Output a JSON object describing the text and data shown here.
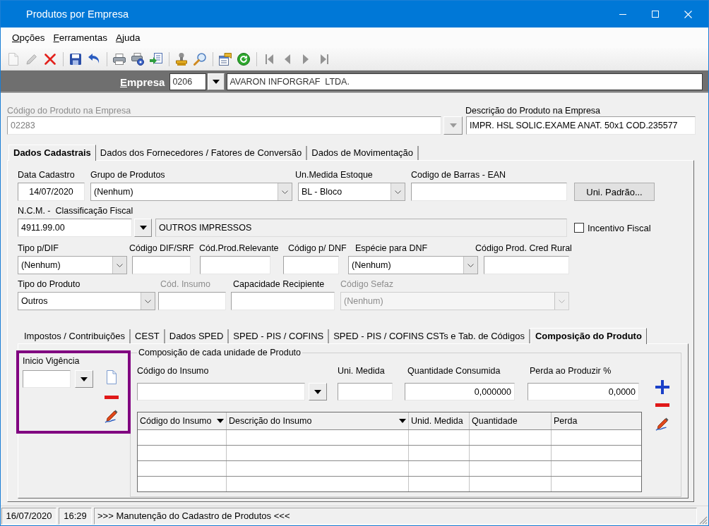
{
  "window": {
    "title": "Produtos por Empresa"
  },
  "menu": [
    "Opções",
    "Ferramentas",
    "Ajuda"
  ],
  "toolbar": [
    [
      {
        "kind": "new",
        "disabled": true
      },
      {
        "kind": "edit",
        "disabled": true
      },
      {
        "kind": "delete",
        "disabled": false
      }
    ],
    [
      {
        "kind": "save",
        "disabled": false
      },
      {
        "kind": "undo",
        "disabled": false
      }
    ],
    [
      {
        "kind": "print",
        "disabled": false
      },
      {
        "kind": "print_setup",
        "disabled": false
      },
      {
        "kind": "export",
        "disabled": false
      }
    ],
    [
      {
        "kind": "stamp",
        "disabled": false
      },
      {
        "kind": "search",
        "disabled": false
      }
    ],
    [
      {
        "kind": "properties",
        "disabled": false
      },
      {
        "kind": "refresh",
        "disabled": false
      }
    ],
    [
      {
        "kind": "first",
        "disabled": true
      },
      {
        "kind": "previous",
        "disabled": true
      },
      {
        "kind": "next",
        "disabled": true
      },
      {
        "kind": "last",
        "disabled": true
      }
    ]
  ],
  "company": {
    "label": "Empresa",
    "code": "0206",
    "name": "AVARON INFORGRAF  LTDA."
  },
  "product": {
    "code": {
      "label": "Código do Produto na Empresa",
      "value": "02283",
      "disabled": true
    },
    "description": {
      "label": "Descrição do Produto na Empresa",
      "value": "IMPR. HSL SOLIC.EXAME ANAT. 50x1 COD.235577"
    }
  },
  "tabs": [
    {
      "label": "Dados Cadastrais",
      "selected": true
    },
    {
      "label": "Dados dos Fornecedores / Fatores de Conversão",
      "selected": false
    },
    {
      "label": "Dados de Movimentação",
      "selected": false
    }
  ],
  "general_rows": [
    [
      {
        "kind": "date",
        "label": "Data Cadastro",
        "value": "14/07/2020",
        "disabled": false
      },
      {
        "kind": "combo",
        "label": "Grupo de Produtos",
        "value": "(Nenhum)",
        "disabled": false
      },
      {
        "kind": "combo",
        "label": "Un.Medida Estoque",
        "value": "BL - Bloco",
        "disabled": false
      },
      {
        "kind": "text",
        "label": "Codigo de Barras - EAN",
        "disabled": false
      },
      {
        "kind": "button",
        "label": "Uni. Padrão...",
        "disabled": false
      }
    ],
    [
      {
        "kind": "lookup",
        "label": "N.C.M. -  Classificação Fiscal",
        "value": "4911.99.00",
        "description": "OUTROS IMPRESSOS",
        "disabled": false
      },
      {
        "kind": "checkbox",
        "label": "Incentivo Fiscal",
        "checked": false,
        "disabled": false
      }
    ],
    [
      {
        "kind": "combo",
        "label": "Tipo p/DIF",
        "value": "(Nenhum)",
        "disabled": false
      },
      {
        "kind": "text",
        "label": "Código DIF/SRF",
        "disabled": false
      },
      {
        "kind": "text",
        "label": "Cód.Prod.Relevante",
        "disabled": false
      },
      {
        "kind": "text",
        "label": "Código p/ DNF",
        "disabled": false
      },
      {
        "kind": "combo",
        "label": "Espécie para DNF",
        "value": "(Nenhum)",
        "disabled": false
      },
      {
        "kind": "text",
        "label": "Código Prod. Cred Rural",
        "disabled": false
      }
    ],
    [
      {
        "kind": "combo",
        "label": "Tipo do Produto",
        "value": "Outros",
        "disabled": false
      },
      {
        "kind": "text",
        "label": "Cód. Insumo",
        "disabled": true
      },
      {
        "kind": "text",
        "label": "Capacidade Recipiente",
        "disabled": false
      },
      {
        "kind": "combo",
        "label": "Código Sefaz",
        "value": "(Nenhum)",
        "disabled": true
      }
    ]
  ],
  "sub_tabs": [
    {
      "label": "Impostos / Contribuições",
      "selected": false
    },
    {
      "label": "CEST",
      "selected": false
    },
    {
      "label": "Dados SPED",
      "selected": false
    },
    {
      "label": "SPED - PIS / COFINS",
      "selected": false
    },
    {
      "label": "SPED - PIS / COFINS CSTs e Tab. de Códigos",
      "selected": false
    },
    {
      "label": "Composição do Produto",
      "selected": true
    }
  ],
  "validity": {
    "label": "Inicio Vigência",
    "highlighted": true
  },
  "composition": {
    "title": "Composição de cada unidade de Produto",
    "fields": [
      {
        "kind": "lookup",
        "label": "Código do Insumo"
      },
      {
        "kind": "text",
        "label": "Uni. Medida"
      },
      {
        "kind": "number",
        "label": "Quantidade Consumida",
        "value": "0,000000"
      },
      {
        "kind": "number",
        "label": "Perda ao Produzir %",
        "value": "0,0000"
      }
    ],
    "columns": [
      {
        "label": "Código do Insumo",
        "dropdown": true
      },
      {
        "label": "Descrição do Insumo",
        "dropdown": true
      },
      {
        "label": "Unid. Medida",
        "dropdown": false
      },
      {
        "label": "Quantidade",
        "dropdown": false
      },
      {
        "label": "Perda",
        "dropdown": false
      }
    ]
  },
  "status_bar": [
    "16/07/2020",
    "16:29",
    ">>> Manutenção do Cadastro de Produtos <<<"
  ]
}
